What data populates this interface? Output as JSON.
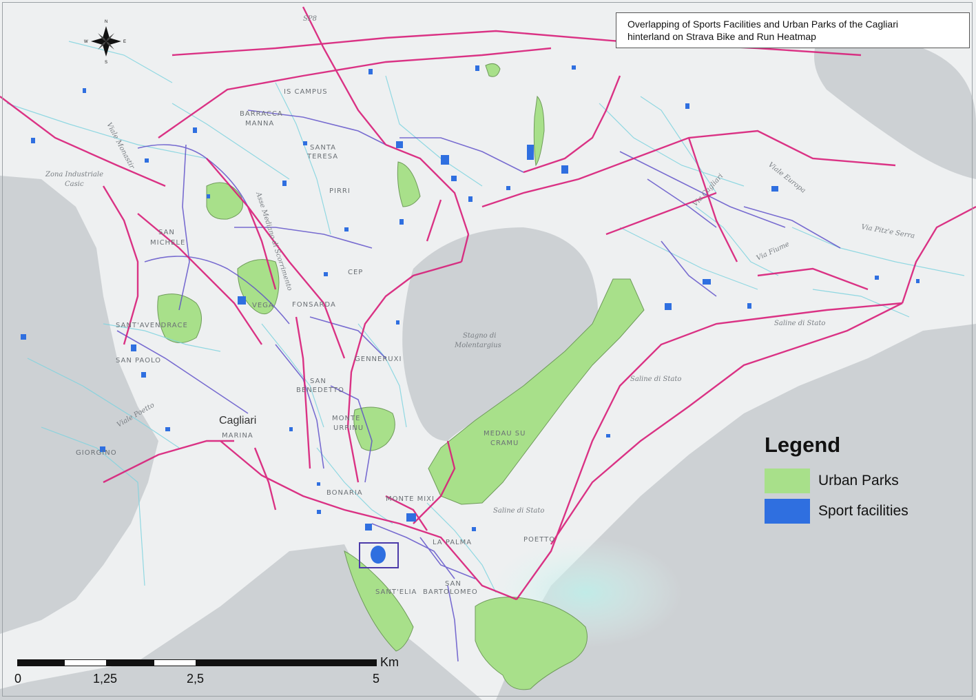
{
  "map_title": {
    "line1": "Overlapping of Sports Facilities and Urban Parks of the Cagliari",
    "line2": "hinterland on Strava Bike and Run Heatmap"
  },
  "legend": {
    "title": "Legend",
    "items": [
      {
        "label": "Urban Parks",
        "color": "#a8e08a"
      },
      {
        "label": "Sport facilities",
        "color": "#2f6fe0"
      }
    ]
  },
  "scale_bar": {
    "unit": "Km",
    "ticks": [
      "0",
      "1,25",
      "2,5",
      "5"
    ]
  },
  "compass": {
    "icon": "north-arrow-icon",
    "n": "N",
    "s": "S",
    "e": "E",
    "w": "W"
  },
  "place_labels": {
    "is_campus": "IS CAMPUS",
    "barracca_manna_1": "BARRACCA",
    "barracca_manna_2": "MANNA",
    "santa_teresa_1": "SANTA",
    "santa_teresa_2": "TERESA",
    "pirri": "PIRRI",
    "san_michele_1": "SAN",
    "san_michele_2": "MICHELE",
    "cep": "CEP",
    "fonsarda": "FONSARDA",
    "sant_avendrace": "SANT'AVENDRACE",
    "san_paolo": "SAN PAOLO",
    "is_mirrionis": "VEGA",
    "genneruxi": "GENNERUXI",
    "san_benedetto_1": "SAN",
    "san_benedetto_2": "BENEDETTO",
    "cagliari": "Cagliari",
    "marina": "MARINA",
    "monte_urpinu_1": "MONTE",
    "monte_urpinu_2": "URPINU",
    "giorgino": "GIORGINO",
    "bonaria": "BONARIA",
    "monte_mixi": "MONTE MIXI",
    "la_palma": "LA PALMA",
    "santelia": "SANT'ELIA",
    "san_bartolomeo": "BARTOLOMEO",
    "san_b_prefix": "SAN",
    "medau_1": "MEDAU SU",
    "medau_2": "CRAMU",
    "poetto": "POETTO",
    "stagno_1": "Stagno di",
    "stagno_2": "Molentargius",
    "saline_1": "Saline di Stato",
    "saline_2": "Saline di Stato",
    "saline_3": "Saline di Stato",
    "zona_ind_1": "Zona Industriale",
    "zona_ind_2": "Casic",
    "via_cagliari": "Via Cagliari",
    "viale_europa": "Viale Europa",
    "via_pitz_serra": "Via Pitz'e Serra",
    "via_fiume": "Via Fiume",
    "viale_monastir": "Viale Monastir",
    "asse_mediano": "Asse Mediano di Scorrimento",
    "viale_poetto": "Viale Poetto",
    "sp8": "SP8"
  }
}
